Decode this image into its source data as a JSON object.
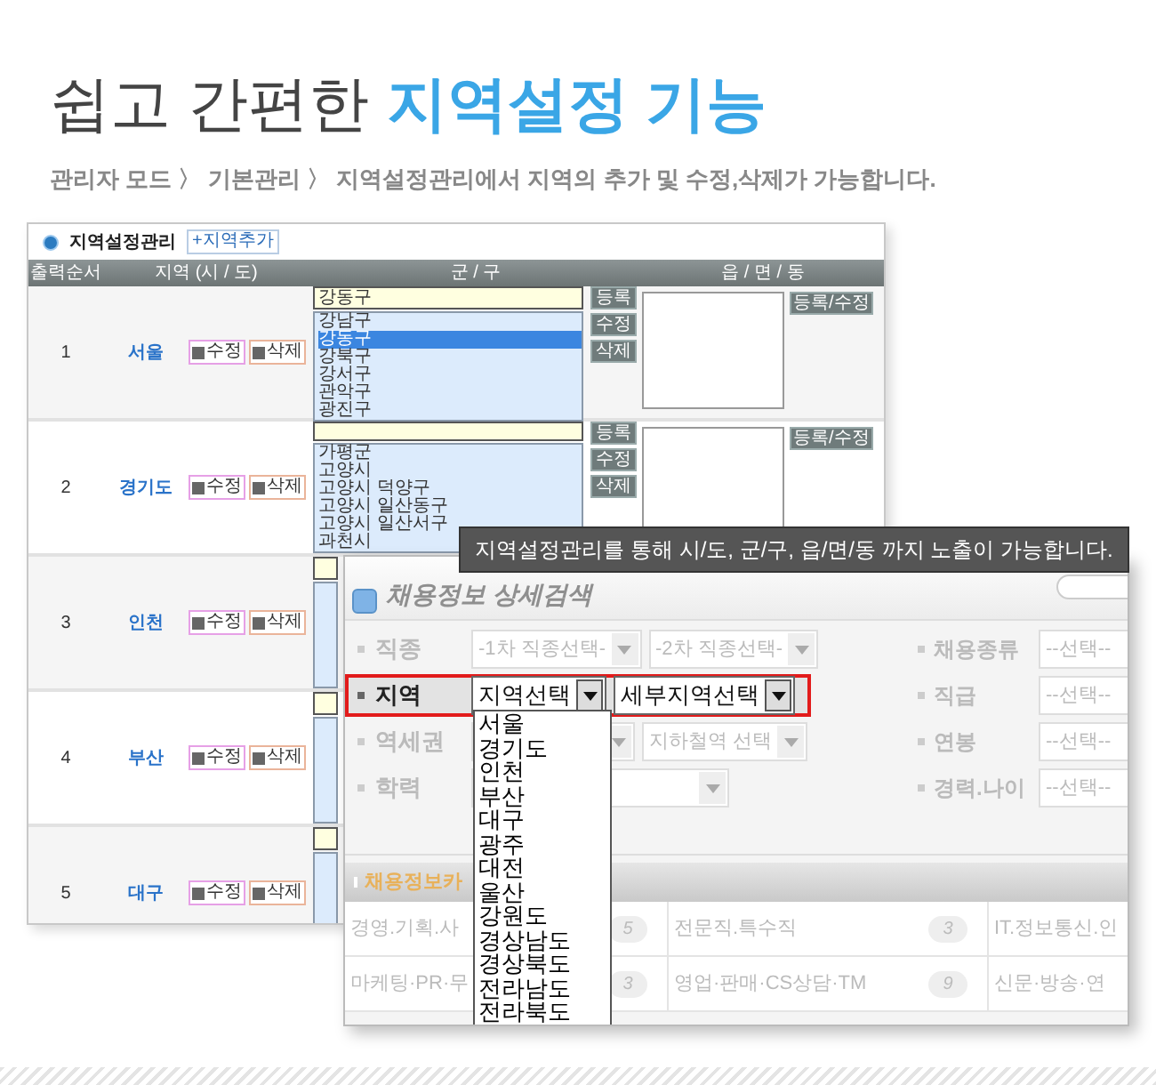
{
  "heading": {
    "text": "쉽고 간편한",
    "highlight": "지역설정 기능"
  },
  "subtitle": "관리자 모드 〉 기본관리 〉 지역설정관리에서 지역의 추가 및 수정,삭제가 가능합니다.",
  "admin": {
    "title": "지역설정관리",
    "add_button": "+지역추가",
    "columns": [
      "출력순서",
      "지역 (시 / 도)",
      "군 / 구",
      "읍 / 면 / 동"
    ],
    "rows": [
      {
        "order": "1",
        "region": "서울",
        "edit": "수정",
        "delete": "삭제",
        "district_input": "강동구",
        "districts": [
          {
            "label": "강남구",
            "selected": false
          },
          {
            "label": "강동구",
            "selected": true
          },
          {
            "label": "강북구",
            "selected": false
          },
          {
            "label": "강서구",
            "selected": false
          },
          {
            "label": "관악구",
            "selected": false
          },
          {
            "label": "광진구",
            "selected": false
          }
        ],
        "actions": [
          "등록",
          "수정",
          "삭제"
        ],
        "dong_action": "등록/수정"
      },
      {
        "order": "2",
        "region": "경기도",
        "edit": "수정",
        "delete": "삭제",
        "districts": [
          {
            "label": "가평군",
            "selected": false
          },
          {
            "label": "고양시",
            "selected": false
          },
          {
            "label": "고양시 덕양구",
            "selected": false
          },
          {
            "label": "고양시 일산동구",
            "selected": false
          },
          {
            "label": "고양시 일산서구",
            "selected": false
          },
          {
            "label": "과천시",
            "selected": false
          }
        ],
        "actions": [
          "등록",
          "수정",
          "삭제"
        ],
        "dong_action": "등록/수정"
      },
      {
        "order": "3",
        "region": "인천",
        "edit": "수정",
        "delete": "삭제"
      },
      {
        "order": "4",
        "region": "부산",
        "edit": "수정",
        "delete": "삭제"
      },
      {
        "order": "5",
        "region": "대구",
        "edit": "수정",
        "delete": "삭제"
      }
    ]
  },
  "tooltip": "지역설정관리를 통해 시/도, 군/구, 읍/면/동 까지 노출이 가능합니다.",
  "search": {
    "title": "채용정보 상세검색",
    "rows": [
      {
        "label": "직종",
        "highlighted": false,
        "selects": [
          {
            "value": "-1차 직종선택-"
          },
          {
            "value": "-2차 직종선택-"
          }
        ]
      },
      {
        "label": "지역",
        "highlighted": true,
        "selects": [
          {
            "value": "지역선택"
          },
          {
            "value": "세부지역선택"
          }
        ]
      },
      {
        "label": "역세권",
        "highlighted": false,
        "selects": [
          {
            "kind": "blank"
          },
          {
            "value": "지하철역 선택"
          }
        ]
      },
      {
        "label": "학력",
        "highlighted": false,
        "selects": [
          {
            "kind": "blank"
          }
        ]
      }
    ],
    "side": [
      {
        "label": "채용종류",
        "value": "--선택--"
      },
      {
        "label": "직급",
        "value": "--선택--"
      },
      {
        "label": "연봉",
        "value": "--선택--"
      },
      {
        "label": "경력.나이",
        "value": "--선택--"
      }
    ],
    "dropdown": [
      "서울",
      "경기도",
      "인천",
      "부산",
      "대구",
      "광주",
      "대전",
      "울산",
      "강원도",
      "경상남도",
      "경상북도",
      "전라남도",
      "전라북도"
    ],
    "category": {
      "title": "채용정보카",
      "rows": [
        [
          {
            "name": "경영.기획.사",
            "count": "5"
          },
          {
            "name": "전문직.특수직",
            "count": "3"
          },
          {
            "name": "IT.정보통신.인"
          }
        ],
        [
          {
            "name": "마케팅·PR·무",
            "count": "3"
          },
          {
            "name": "영업·판매·CS상담·TM",
            "count": "9"
          },
          {
            "name": "신문·방송·연"
          }
        ]
      ]
    }
  }
}
